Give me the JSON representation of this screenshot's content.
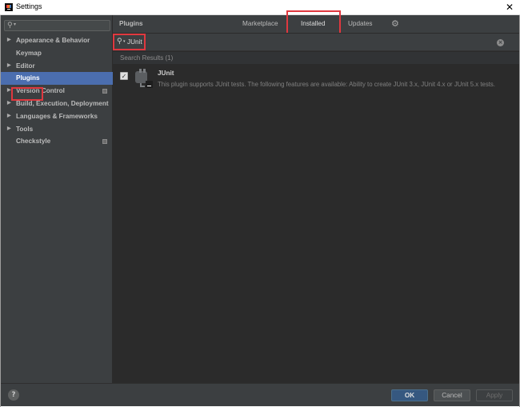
{
  "window": {
    "title": "Settings",
    "close_glyph": "✕"
  },
  "sidebar": {
    "search_placeholder": "",
    "items": [
      {
        "label": "Appearance & Behavior",
        "expandable": true
      },
      {
        "label": "Keymap",
        "expandable": false
      },
      {
        "label": "Editor",
        "expandable": true
      },
      {
        "label": "Plugins",
        "expandable": false,
        "selected": true
      },
      {
        "label": "Version Control",
        "expandable": true,
        "project_icon": true
      },
      {
        "label": "Build, Execution, Deployment",
        "expandable": true
      },
      {
        "label": "Languages & Frameworks",
        "expandable": true
      },
      {
        "label": "Tools",
        "expandable": true
      },
      {
        "label": "Checkstyle",
        "expandable": false,
        "project_icon": true
      }
    ]
  },
  "header": {
    "title": "Plugins",
    "tabs": [
      {
        "label": "Marketplace"
      },
      {
        "label": "Installed",
        "active": true
      },
      {
        "label": "Updates"
      }
    ],
    "gear_icon": "gear-icon"
  },
  "search": {
    "value": "JUnit",
    "clear_icon": "clear-icon"
  },
  "results": {
    "header": "Search Results (1)",
    "plugins": [
      {
        "name": "JUnit",
        "enabled": true,
        "description": "This plugin supports JUnit tests. The following features are available: Ability to create JUnit 3.x, JUnit 4.x or JUnit 5.x tests."
      }
    ]
  },
  "footer": {
    "help_label": "?",
    "ok_label": "OK",
    "cancel_label": "Cancel",
    "apply_label": "Apply"
  },
  "colors": {
    "selection": "#4b6eaf",
    "highlight_red": "#e0383f",
    "panel_bg": "#3c3f41",
    "content_bg": "#2b2b2b",
    "ok_button": "#365880"
  }
}
